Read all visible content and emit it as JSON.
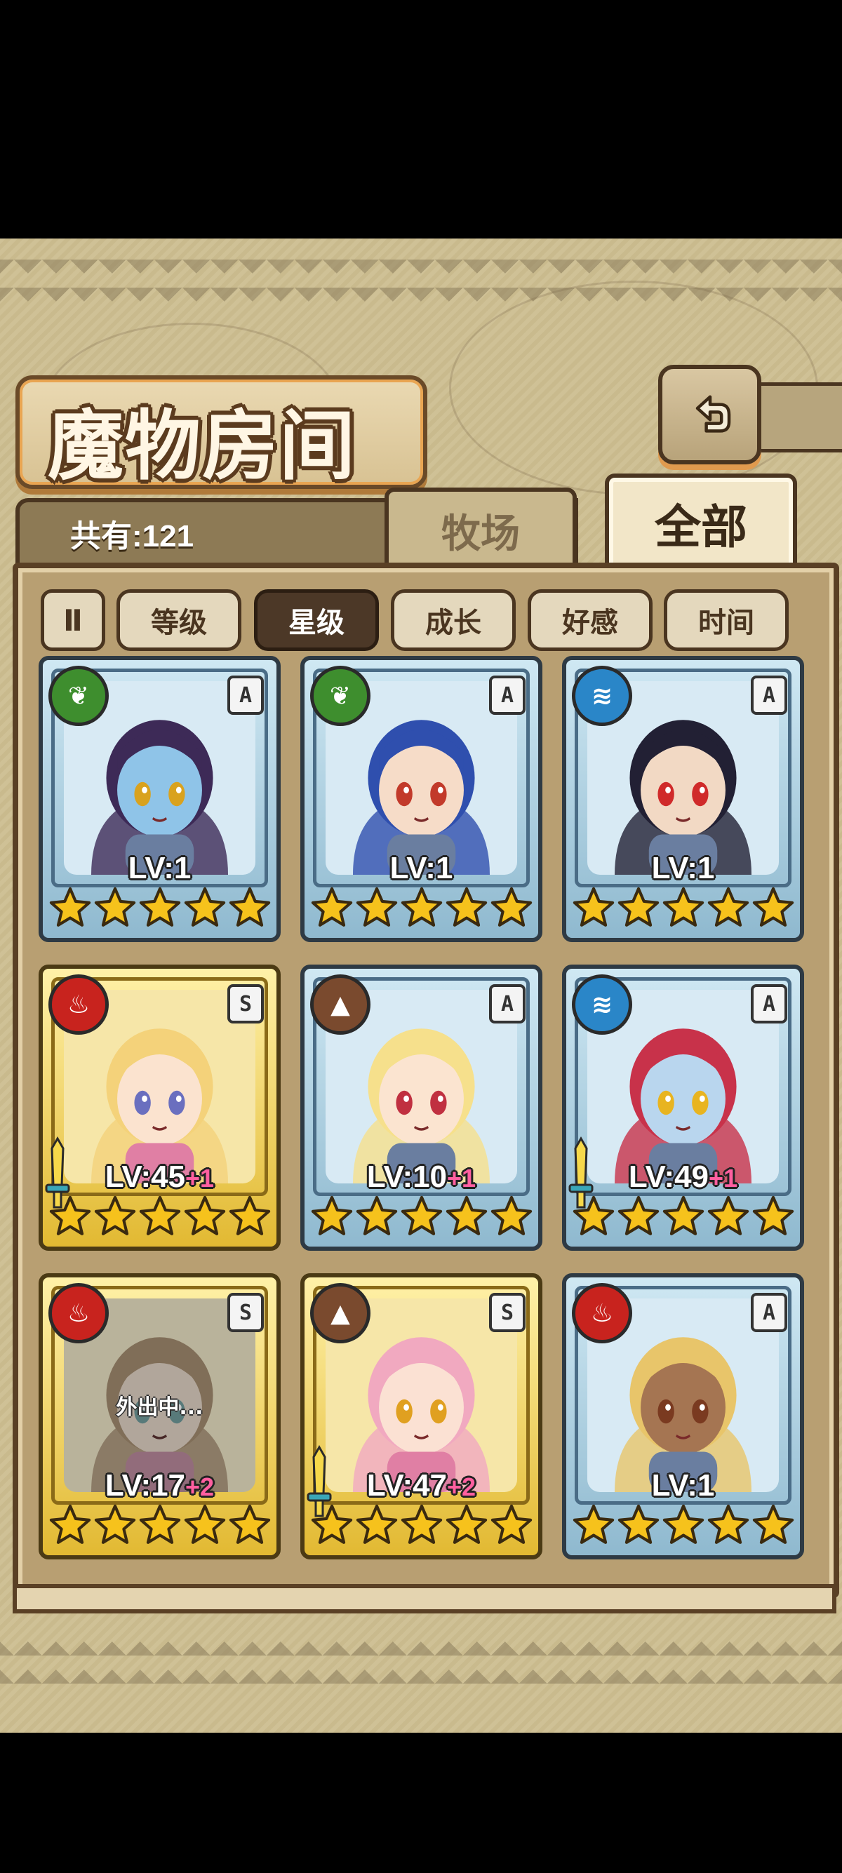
{
  "header": {
    "title": "魔物房间",
    "back_icon": "return-arrow-icon"
  },
  "collection": {
    "count_label": "共有:121"
  },
  "tabs": [
    {
      "label": "牧场",
      "active": false
    },
    {
      "label": "全部",
      "active": true
    }
  ],
  "sort": {
    "toggle_label": "Ⅱ",
    "buttons": [
      {
        "label": "等级",
        "active": false
      },
      {
        "label": "星级",
        "active": true
      },
      {
        "label": "成长",
        "active": false
      },
      {
        "label": "好感",
        "active": false
      },
      {
        "label": "时间",
        "active": false
      }
    ]
  },
  "colors": {
    "leaf": "#3e8e2e",
    "water": "#2a86c8",
    "fire": "#c8231e",
    "earth": "#7a4a2e",
    "star": "#f6c21c"
  },
  "cards": [
    {
      "element": "leaf",
      "rank": "A",
      "lv": "LV:1",
      "bonus": "",
      "stars": 5,
      "frame": "blue",
      "weapon": false,
      "away": ""
    },
    {
      "element": "leaf",
      "rank": "A",
      "lv": "LV:1",
      "bonus": "",
      "stars": 5,
      "frame": "blue",
      "weapon": false,
      "away": ""
    },
    {
      "element": "water",
      "rank": "A",
      "lv": "LV:1",
      "bonus": "",
      "stars": 5,
      "frame": "blue",
      "weapon": false,
      "away": ""
    },
    {
      "element": "fire",
      "rank": "S",
      "lv": "LV:45",
      "bonus": "+1",
      "stars": 5,
      "frame": "gold",
      "weapon": true,
      "away": ""
    },
    {
      "element": "earth",
      "rank": "A",
      "lv": "LV:10",
      "bonus": "+1",
      "stars": 5,
      "frame": "blue",
      "weapon": false,
      "away": ""
    },
    {
      "element": "water",
      "rank": "A",
      "lv": "LV:49",
      "bonus": "+1",
      "stars": 5,
      "frame": "blue",
      "weapon": true,
      "away": ""
    },
    {
      "element": "fire",
      "rank": "S",
      "lv": "LV:17",
      "bonus": "+2",
      "stars": 5,
      "frame": "gold",
      "weapon": false,
      "away": "外出中..."
    },
    {
      "element": "earth",
      "rank": "S",
      "lv": "LV:47",
      "bonus": "+2",
      "stars": 5,
      "frame": "gold",
      "weapon": true,
      "away": ""
    },
    {
      "element": "fire",
      "rank": "A",
      "lv": "LV:1",
      "bonus": "",
      "stars": 5,
      "frame": "blue",
      "weapon": false,
      "away": ""
    }
  ]
}
